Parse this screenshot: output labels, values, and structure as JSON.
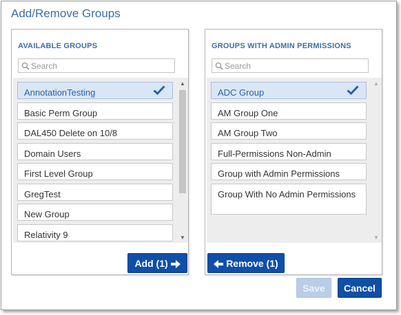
{
  "dialog": {
    "title": "Add/Remove Groups"
  },
  "available": {
    "header": "AVAILABLE GROUPS",
    "search_placeholder": "Search",
    "items": [
      {
        "label": "AnnotationTesting",
        "selected": true
      },
      {
        "label": "Basic Perm Group",
        "selected": false
      },
      {
        "label": "DAL450 Delete on 10/8",
        "selected": false
      },
      {
        "label": "Domain Users",
        "selected": false
      },
      {
        "label": "First Level Group",
        "selected": false
      },
      {
        "label": "GregTest",
        "selected": false
      },
      {
        "label": "New Group",
        "selected": false
      },
      {
        "label": "Relativity 9",
        "selected": false
      }
    ],
    "action_label": "Add (1)",
    "action_icon": "arrow-right-icon"
  },
  "admin": {
    "header": "GROUPS WITH ADMIN PERMISSIONS",
    "search_placeholder": "Search",
    "items": [
      {
        "label": "ADC Group",
        "selected": true
      },
      {
        "label": "AM Group One",
        "selected": false
      },
      {
        "label": "AM Group Two",
        "selected": false
      },
      {
        "label": "Full-Permissions Non-Admin",
        "selected": false
      },
      {
        "label": "Group with Admin Permissions",
        "selected": false
      },
      {
        "label": "Group With No Admin Permissions",
        "selected": false
      }
    ],
    "action_label": "Remove (1)",
    "action_icon": "arrow-left-icon"
  },
  "footer": {
    "save_label": "Save",
    "cancel_label": "Cancel"
  },
  "colors": {
    "accent": "#0f4fa8",
    "title": "#3c6ea8",
    "selected_bg": "#d9e6f5",
    "check": "#2d62a0"
  }
}
